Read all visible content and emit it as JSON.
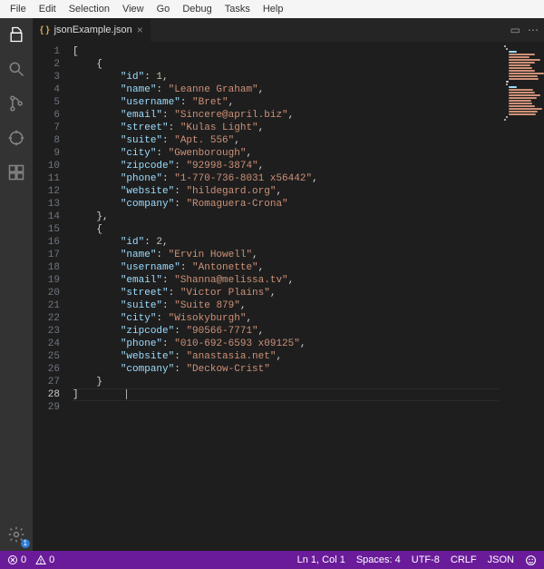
{
  "menu": [
    "File",
    "Edit",
    "Selection",
    "View",
    "Go",
    "Debug",
    "Tasks",
    "Help"
  ],
  "tab": {
    "filename": "jsonExample.json"
  },
  "gear_badge": "1",
  "code": {
    "records": [
      {
        "id": 1,
        "name": "Leanne Graham",
        "username": "Bret",
        "email": "Sincere@april.biz",
        "street": "Kulas Light",
        "suite": "Apt. 556",
        "city": "Gwenborough",
        "zipcode": "92998-3874",
        "phone": "1-770-736-8031 x56442",
        "website": "hildegard.org",
        "company": "Romaguera-Crona"
      },
      {
        "id": 2,
        "name": "Ervin Howell",
        "username": "Antonette",
        "email": "Shanna@melissa.tv",
        "street": "Victor Plains",
        "suite": "Suite 879",
        "city": "Wisokyburgh",
        "zipcode": "90566-7771",
        "phone": "010-692-6593 x09125",
        "website": "anastasia.net",
        "company": "Deckow-Crist"
      }
    ],
    "key_order": [
      "id",
      "name",
      "username",
      "email",
      "street",
      "suite",
      "city",
      "zipcode",
      "phone",
      "website",
      "company"
    ],
    "record_indent": "        ",
    "brace_indent": "    ",
    "caret_line": 28,
    "last_line": 29
  },
  "status": {
    "errors": "0",
    "warnings": "0",
    "ln_col": "Ln 1, Col 1",
    "spaces": "Spaces: 4",
    "encoding": "UTF-8",
    "eol": "CRLF",
    "lang": "JSON"
  }
}
